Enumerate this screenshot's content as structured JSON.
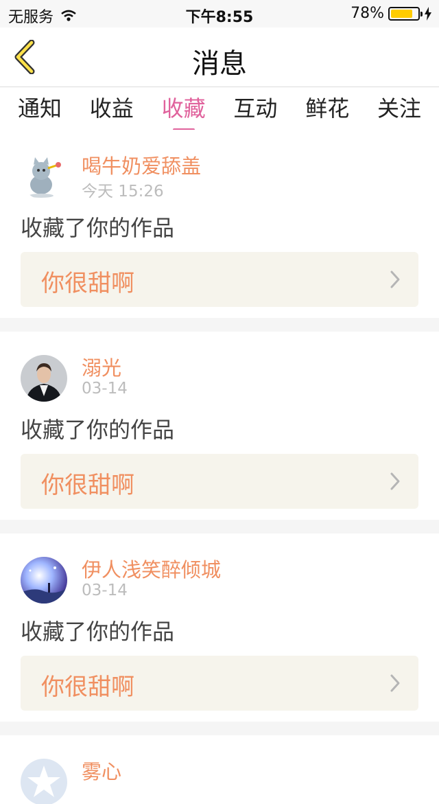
{
  "status": {
    "carrier": "无服务",
    "time": "下午8:55",
    "battery": "78%",
    "battery_level": 0.78
  },
  "nav": {
    "title": "消息"
  },
  "tabs": [
    {
      "label": "通知",
      "active": false
    },
    {
      "label": "收益",
      "active": false
    },
    {
      "label": "收藏",
      "active": true
    },
    {
      "label": "互动",
      "active": false
    },
    {
      "label": "鲜花",
      "active": false
    },
    {
      "label": "关注",
      "active": false
    }
  ],
  "messages": [
    {
      "username": "喝牛奶爱舔盖",
      "time": "今天 15:26",
      "action": "收藏了你的作品",
      "work_title": "你很甜啊",
      "avatar": "cartoon-cat-avatar"
    },
    {
      "username": "溺光",
      "time": "03-14",
      "action": "收藏了你的作品",
      "work_title": "你很甜啊",
      "avatar": "man-photo-avatar"
    },
    {
      "username": "伊人浅笑醉倾城",
      "time": "03-14",
      "action": "收藏了你的作品",
      "work_title": "你很甜啊",
      "avatar": "night-sky-avatar"
    },
    {
      "username": "雾心",
      "avatar": "star-avatar"
    }
  ],
  "colors": {
    "accent": "#e0629c",
    "username": "#f08f60",
    "work_bg": "#f6f4ec"
  }
}
